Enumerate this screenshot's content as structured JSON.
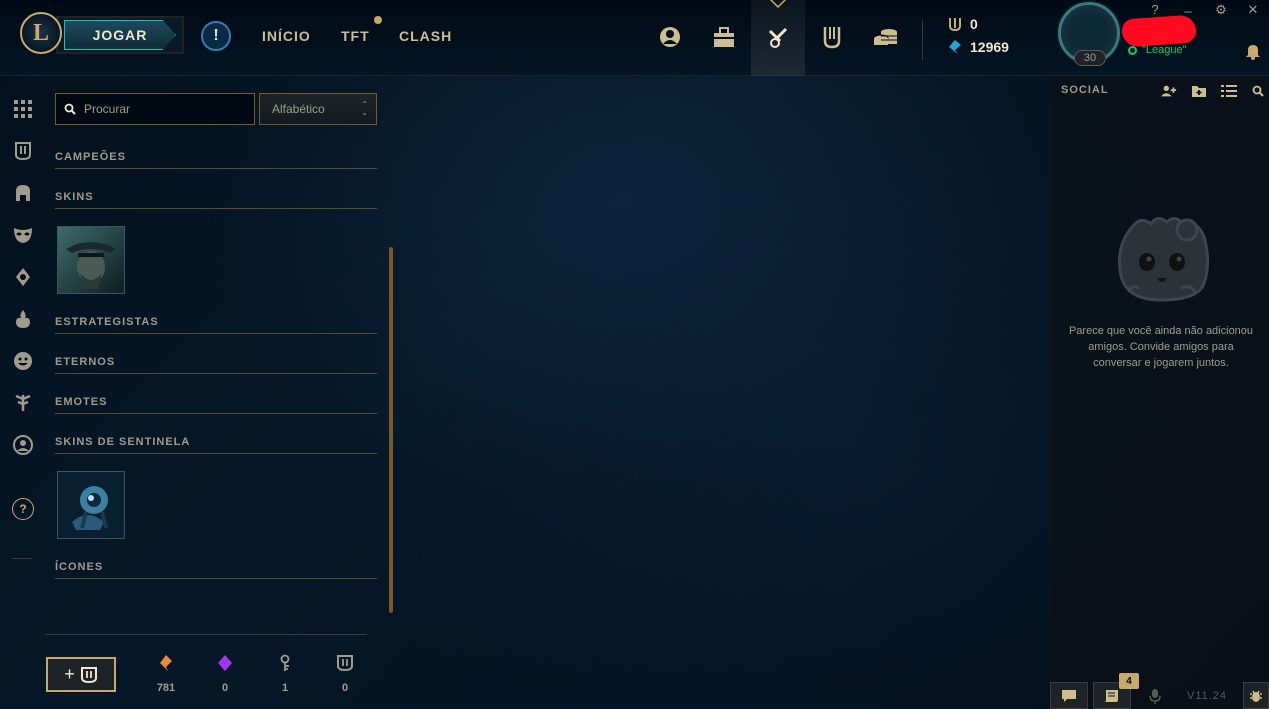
{
  "topbar": {
    "play_label": "JOGAR",
    "nav": [
      "INÍCIO",
      "TFT",
      "CLASH"
    ],
    "icons": [
      "profile-icon",
      "collection-bag-icon",
      "crafting-icon",
      "store-icon",
      "loot-coins-icon"
    ],
    "currency": {
      "rp": "0",
      "be": "12969"
    },
    "profile": {
      "level": "30",
      "status": "\"League\""
    },
    "window": {
      "help": "?",
      "minimize": "_",
      "settings": "⚙",
      "close": "✕"
    }
  },
  "left_nav": {
    "icons": [
      "overview-grid-icon",
      "collection-icon",
      "champion-helmet-icon",
      "skin-mask-icon",
      "tft-little-legend-icon",
      "ward-icon",
      "emote-icon",
      "tree-icon",
      "profile-icon-icon"
    ],
    "help": "?"
  },
  "collection": {
    "search_placeholder": "Procurar",
    "sort_label": "Alfabético",
    "sections": {
      "campeoes": "CAMPEÕES",
      "skins": "SKINS",
      "estrategistas": "ESTRATEGISTAS",
      "eternos": "ETERNOS",
      "emotes": "EMOTES",
      "sentinela": "SKINS DE SENTINELA",
      "icones": "ÍCONES"
    }
  },
  "loot": {
    "add_label": "+",
    "items": [
      {
        "name": "orange-essence",
        "count": "781",
        "color": "#e8883a"
      },
      {
        "name": "mythic-essence",
        "count": "0",
        "color": "#a335ee"
      },
      {
        "name": "key",
        "count": "1",
        "color": "#a09b8c"
      },
      {
        "name": "chest",
        "count": "0",
        "color": "#a09b8c"
      }
    ]
  },
  "social": {
    "title": "SOCIAL",
    "empty_message": "Parece que você ainda não adicionou amigos. Convide amigos para conversar e jogarem juntos.",
    "missions_badge": "4",
    "version": "V11.24"
  },
  "colors": {
    "gold": "#c8aa6e",
    "teal": "#0ac8b9",
    "online": "#0acb6c",
    "bg": "#010a13"
  }
}
